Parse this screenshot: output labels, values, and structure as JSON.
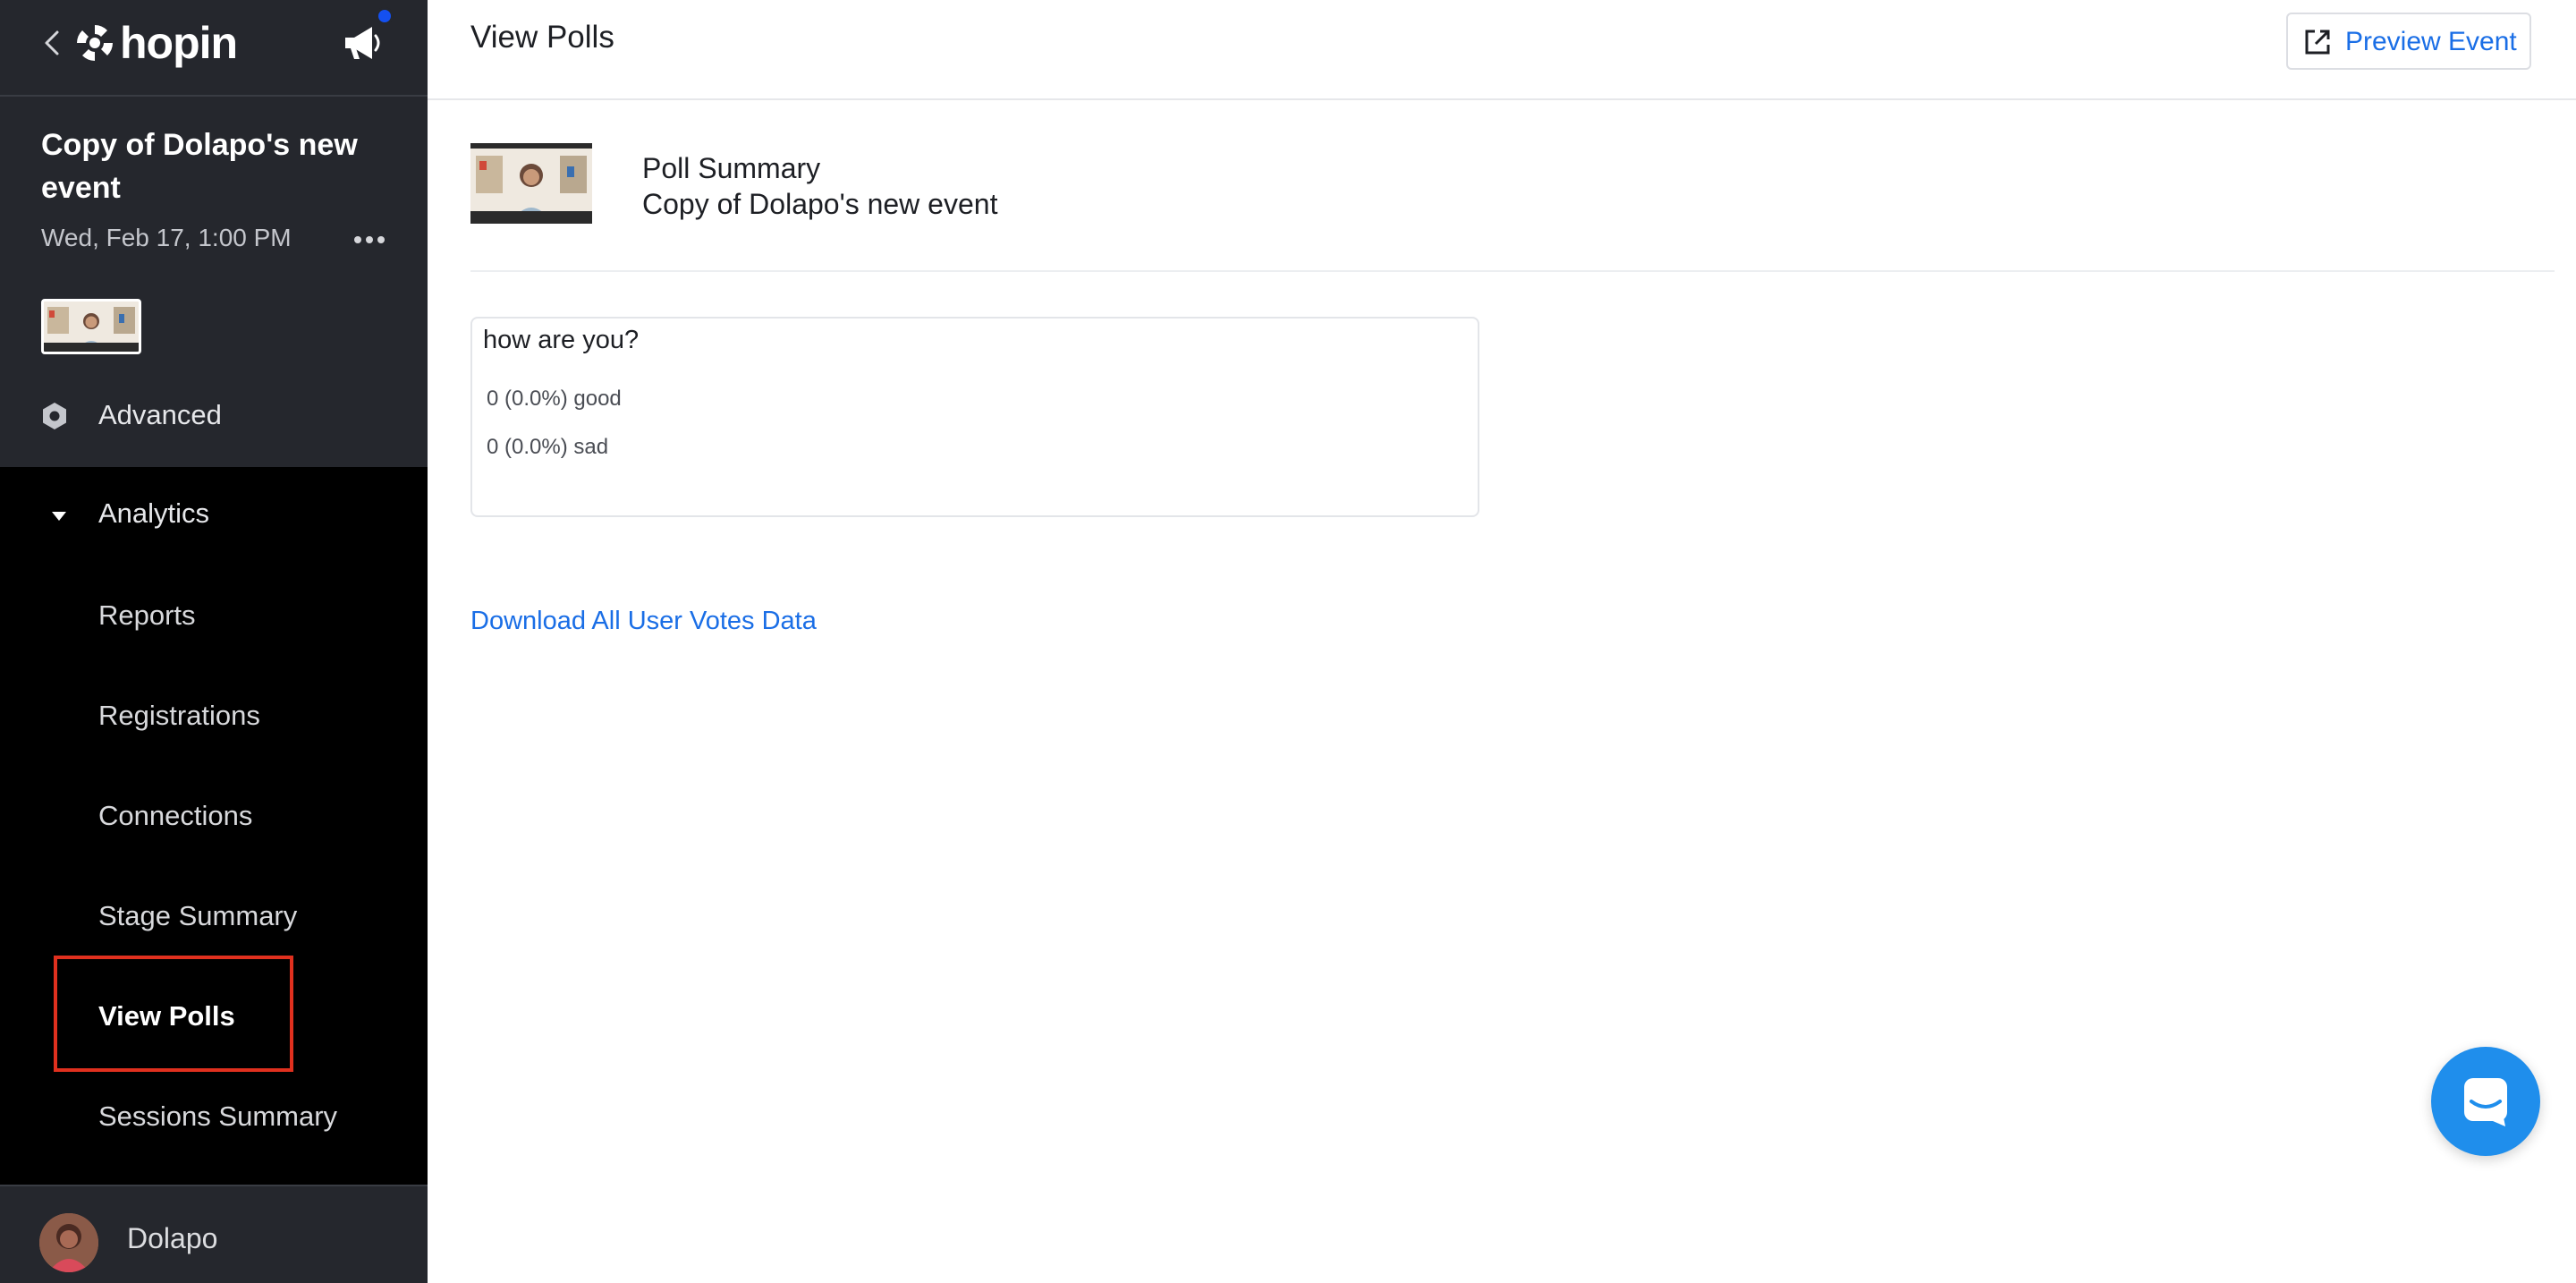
{
  "sidebar": {
    "brand": "hopin",
    "event_name": "Copy of Dolapo's new event",
    "event_date": "Wed, Feb 17, 1:00 PM",
    "nav": {
      "advanced": "Advanced",
      "analytics": "Analytics",
      "sub_items": [
        "Reports",
        "Registrations",
        "Connections",
        "Stage Summary",
        "View Polls",
        "Sessions Summary"
      ]
    },
    "user_name": "Dolapo"
  },
  "header": {
    "title": "View Polls",
    "preview_label": "Preview Event"
  },
  "summary": {
    "title": "Poll Summary",
    "event_name": "Copy of Dolapo's new event"
  },
  "poll": {
    "question": "how are you?",
    "options": [
      "0 (0.0%) good",
      "0 (0.0%) sad"
    ]
  },
  "download_label": "Download All User Votes Data",
  "colors": {
    "sidebar_bg": "#000000",
    "sidebar_top_bg": "#25272d",
    "accent_link": "#1a6ee6",
    "highlight": "#e0301e",
    "chat_button": "#1f8eec"
  }
}
